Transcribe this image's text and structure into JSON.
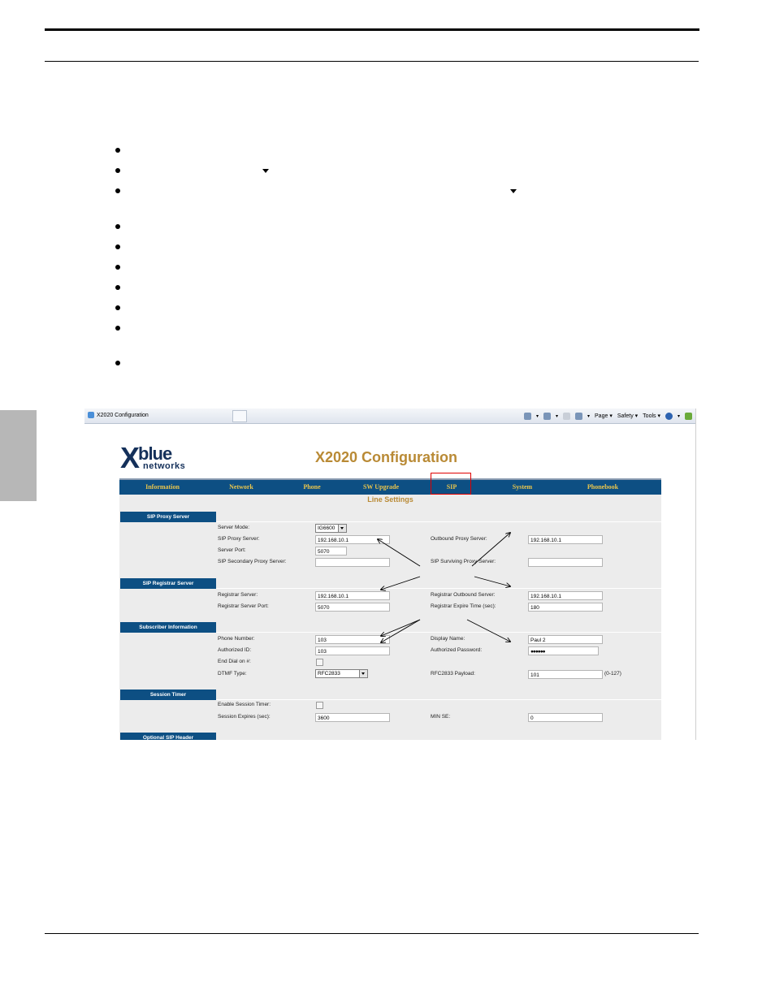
{
  "browser": {
    "tab_title": "X2020 Configuration",
    "toolbar": {
      "page": "Page",
      "safety": "Safety",
      "tools": "Tools"
    }
  },
  "app": {
    "title": "X2020 Configuration",
    "logo": {
      "x": "X",
      "blue": "blue",
      "networks": "networks"
    },
    "nav": [
      "Information",
      "Network",
      "Phone",
      "SW Upgrade",
      "SIP",
      "System",
      "Phonebook"
    ],
    "selected_nav": "SIP",
    "page_subtitle": "Line Settings"
  },
  "sections": {
    "proxy": {
      "title": "SIP Proxy Server",
      "server_mode_label": "Server Mode:",
      "server_mode_value": "IG6600",
      "proxy_server_label": "SIP Proxy Server:",
      "proxy_server_value": "192.168.10.1",
      "server_port_label": "Server Port:",
      "server_port_value": "5070",
      "secondary_label": "SIP Secondary Proxy Server:",
      "secondary_value": "",
      "outbound_label": "Outbound Proxy Server:",
      "outbound_value": "192.168.10.1",
      "surviving_label": "SIP Surviving Proxy Server:",
      "surviving_value": ""
    },
    "registrar": {
      "title": "SIP Registrar Server",
      "registrar_label": "Registrar Server:",
      "registrar_value": "192.168.10.1",
      "registrar_port_label": "Registrar Server Port:",
      "registrar_port_value": "5070",
      "registrar_outbound_label": "Registrar Outbound Server:",
      "registrar_outbound_value": "192.168.10.1",
      "expire_label": "Registrar Expire Time (sec):",
      "expire_value": "180"
    },
    "subscriber": {
      "title": "Subscriber Information",
      "phone_label": "Phone Number:",
      "phone_value": "103",
      "auth_id_label": "Authorized ID:",
      "auth_id_value": "103",
      "end_dial_label": "End Dial on #:",
      "dtmf_label": "DTMF Type:",
      "dtmf_value": "RFC2833",
      "display_name_label": "Display Name:",
      "display_name_value": "Paul 2",
      "auth_pwd_label": "Authorized Password:",
      "auth_pwd_value": "●●●●●●",
      "payload_label": "RFC2833 Payload:",
      "payload_value": "101",
      "payload_range": "(0-127)"
    },
    "session": {
      "title": "Session Timer",
      "enable_label": "Enable Session Timer:",
      "expires_label": "Session Expires (sec):",
      "expires_value": "3600",
      "min_se_label": "MIN SE:",
      "min_se_value": "0"
    },
    "optional": {
      "title": "Optional SIP Header"
    }
  }
}
